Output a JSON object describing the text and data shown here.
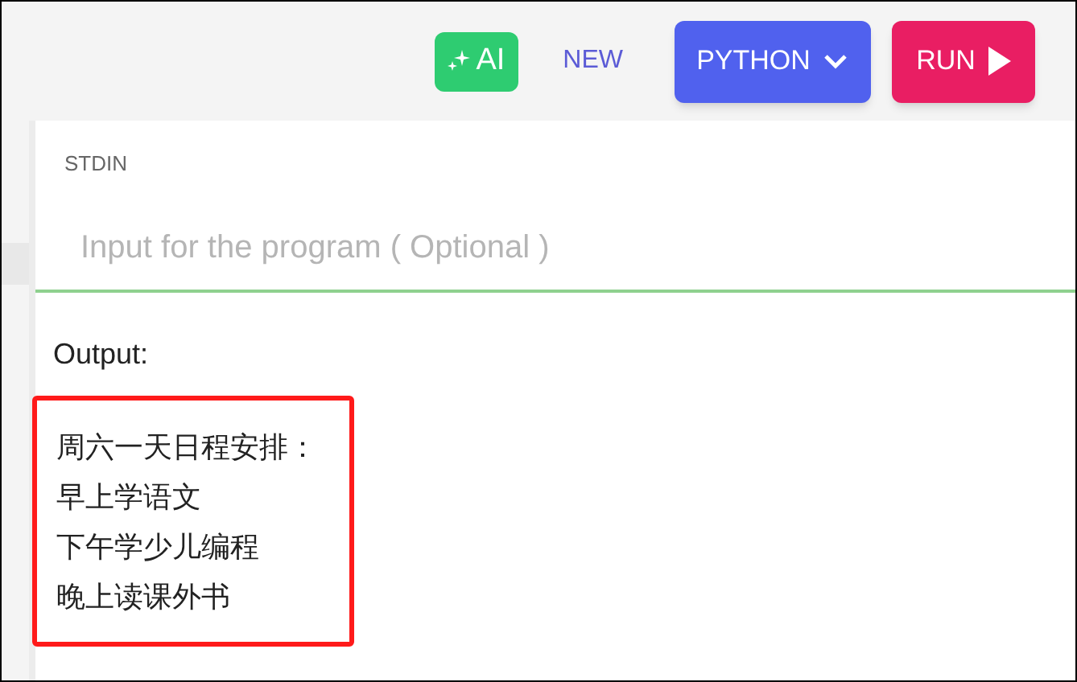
{
  "toolbar": {
    "ai_button": "AI",
    "new_button": "NEW",
    "language_button": "PYTHON",
    "run_button": "RUN"
  },
  "stdin": {
    "label": "STDIN",
    "placeholder": "Input for the program ( Optional )"
  },
  "output": {
    "label": "Output:",
    "highlighted": true,
    "lines": [
      "周六一天日程安排：",
      "早上学语文",
      "下午学少儿编程",
      "晚上读课外书"
    ]
  }
}
